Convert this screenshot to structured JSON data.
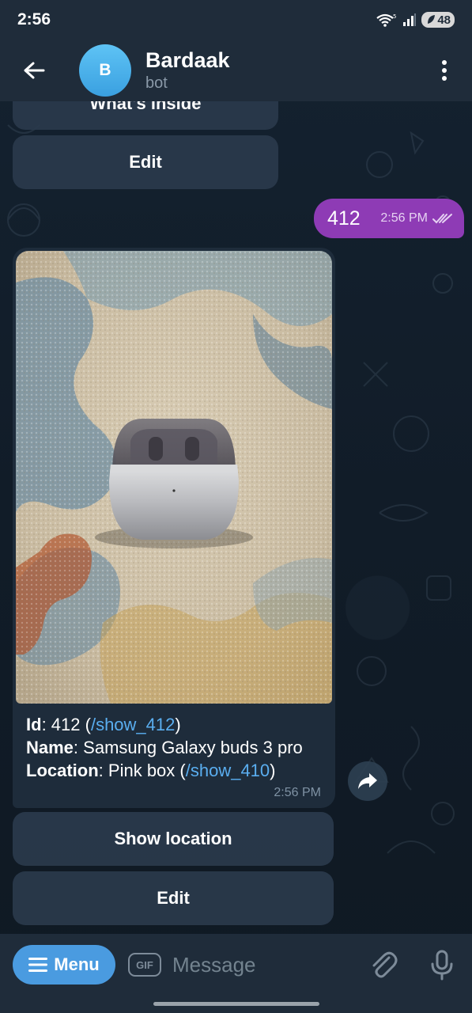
{
  "status_bar": {
    "time": "2:56",
    "battery": "48"
  },
  "header": {
    "avatar_letter": "B",
    "title": "Bardaak",
    "subtitle": "bot"
  },
  "messages": {
    "prev_keyboard": {
      "partial_label": "What's inside",
      "edit_label": "Edit"
    },
    "outgoing": {
      "text": "412",
      "time": "2:56 PM",
      "status": "read"
    },
    "incoming": {
      "photo_alt": "Samsung Galaxy buds 3 pro",
      "fields": [
        {
          "label": "Id",
          "sep": ": ",
          "value": "412 (",
          "link": "/show_412",
          "tail": ")"
        },
        {
          "label": "Name",
          "sep": ": ",
          "value": "Samsung Galaxy buds 3 pro",
          "link": "",
          "tail": ""
        },
        {
          "label": "Location",
          "sep": ": ",
          "value": "Pink box (",
          "link": "/show_410",
          "tail": ")"
        }
      ],
      "time": "2:56 PM"
    },
    "keyboard": {
      "show_location_label": "Show location",
      "edit_label": "Edit"
    }
  },
  "input_bar": {
    "menu_label": "Menu",
    "gif_label": "GIF",
    "placeholder": "Message"
  },
  "colors": {
    "header_bg": "#1f2c3a",
    "outgoing_bubble": "#8e3bb5",
    "incoming_bubble": "#1e2c3b",
    "link": "#5aaef0",
    "menu_button": "#4a9be0"
  }
}
